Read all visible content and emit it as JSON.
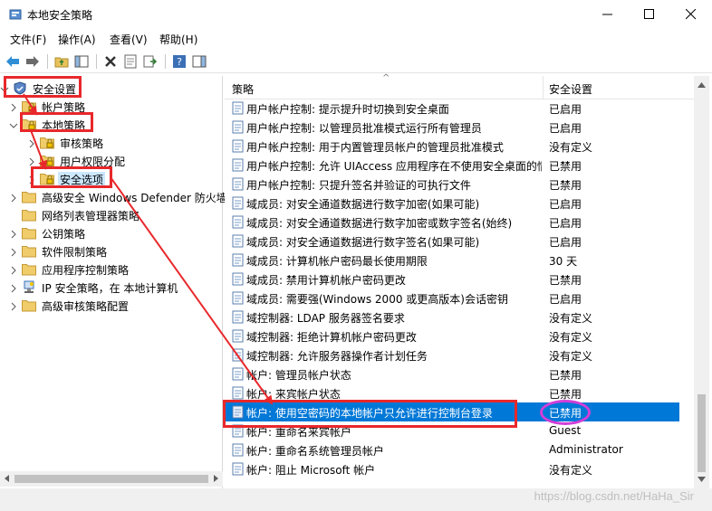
{
  "window": {
    "title": "本地安全策略"
  },
  "menu": [
    "文件(F)",
    "操作(A)",
    "查看(V)",
    "帮助(H)"
  ],
  "tree": [
    {
      "label": "安全设置",
      "level": 0,
      "expander": "open",
      "icon": "shield-icon"
    },
    {
      "label": "帐户策略",
      "level": 1,
      "expander": "closed",
      "icon": "folder-lock-icon"
    },
    {
      "label": "本地策略",
      "level": 1,
      "expander": "open",
      "icon": "folder-lock-icon"
    },
    {
      "label": "审核策略",
      "level": 2,
      "expander": "closed",
      "icon": "folder-lock-icon"
    },
    {
      "label": "用户权限分配",
      "level": 2,
      "expander": "closed",
      "icon": "folder-lock-icon"
    },
    {
      "label": "安全选项",
      "level": 2,
      "expander": "closed",
      "icon": "folder-lock-icon"
    },
    {
      "label": "高级安全 Windows Defender 防火墙",
      "level": 1,
      "expander": "closed",
      "icon": "folder-icon"
    },
    {
      "label": "网络列表管理器策略",
      "level": 1,
      "expander": "none",
      "icon": "folder-icon"
    },
    {
      "label": "公钥策略",
      "level": 1,
      "expander": "closed",
      "icon": "folder-icon"
    },
    {
      "label": "软件限制策略",
      "level": 1,
      "expander": "closed",
      "icon": "folder-icon"
    },
    {
      "label": "应用程序控制策略",
      "level": 1,
      "expander": "closed",
      "icon": "folder-icon"
    },
    {
      "label": "IP 安全策略，在 本地计算机",
      "level": 1,
      "expander": "closed",
      "icon": "ipsec-icon"
    },
    {
      "label": "高级审核策略配置",
      "level": 1,
      "expander": "closed",
      "icon": "folder-icon"
    }
  ],
  "list": {
    "col_policy": "策略",
    "col_setting": "安全设置",
    "rows": [
      {
        "policy": "用户帐户控制: 提示提升时切换到安全桌面",
        "setting": "已启用"
      },
      {
        "policy": "用户帐户控制: 以管理员批准模式运行所有管理员",
        "setting": "已启用"
      },
      {
        "policy": "用户帐户控制: 用于内置管理员帐户的管理员批准模式",
        "setting": "没有定义"
      },
      {
        "policy": "用户帐户控制: 允许 UIAccess 应用程序在不使用安全桌面的情况下提升",
        "setting": "已禁用"
      },
      {
        "policy": "用户帐户控制: 只提升签名并验证的可执行文件",
        "setting": "已禁用"
      },
      {
        "policy": "域成员: 对安全通道数据进行数字加密(如果可能)",
        "setting": "已启用"
      },
      {
        "policy": "域成员: 对安全通道数据进行数字加密或数字签名(始终)",
        "setting": "已启用"
      },
      {
        "policy": "域成员: 对安全通道数据进行数字签名(如果可能)",
        "setting": "已启用"
      },
      {
        "policy": "域成员: 计算机帐户密码最长使用期限",
        "setting": "30 天"
      },
      {
        "policy": "域成员: 禁用计算机帐户密码更改",
        "setting": "已禁用"
      },
      {
        "policy": "域成员: 需要强(Windows 2000 或更高版本)会话密钥",
        "setting": "已启用"
      },
      {
        "policy": "域控制器: LDAP 服务器签名要求",
        "setting": "没有定义"
      },
      {
        "policy": "域控制器: 拒绝计算机帐户密码更改",
        "setting": "没有定义"
      },
      {
        "policy": "域控制器: 允许服务器操作者计划任务",
        "setting": "没有定义"
      },
      {
        "policy": "帐户: 管理员帐户状态",
        "setting": "已禁用"
      },
      {
        "policy": "帐户: 来宾帐户状态",
        "setting": "已禁用"
      },
      {
        "policy": "帐户: 使用空密码的本地帐户只允许进行控制台登录",
        "setting": "已禁用",
        "selected": true
      },
      {
        "policy": "帐户: 重命名来宾帐户",
        "setting": "Guest"
      },
      {
        "policy": "帐户: 重命名系统管理员帐户",
        "setting": "Administrator"
      },
      {
        "policy": "帐户: 阻止 Microsoft 帐户",
        "setting": "没有定义"
      }
    ]
  },
  "watermark": "https://blog.csdn.net/HaHa_Sir",
  "colors": {
    "selection": "#0078d7",
    "annotation": "#e8282b",
    "circle": "#d13fd8"
  }
}
